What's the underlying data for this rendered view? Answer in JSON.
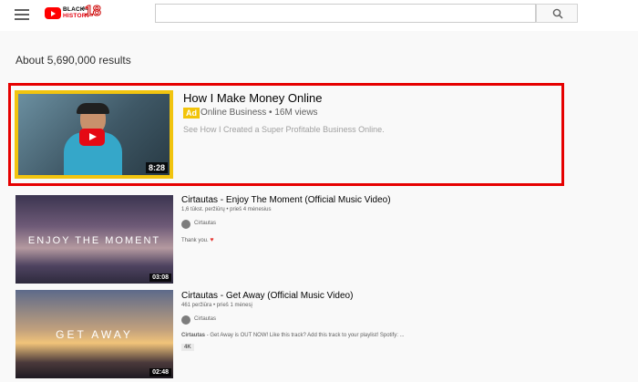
{
  "header": {
    "logo": {
      "line1": "BLACK",
      "line2": "HISTORY",
      "ag": "AG",
      "number": "18"
    },
    "search": {
      "value": "",
      "placeholder": ""
    }
  },
  "results": {
    "count_text": "About 5,690,000 results",
    "ad": {
      "title": "How I Make Money Online",
      "badge": "Ad",
      "meta": "Online Business • 16M views",
      "description": "See How I Created a Super Profitable Business Online.",
      "duration": "8:28"
    },
    "videos": [
      {
        "title": "Cirtautas - Enjoy The Moment (Official Music Video)",
        "stats": "1,6 tūkst. peržiūrų • prieš 4 mėnesius",
        "channel": "Cirtautas",
        "description": "Thank you.",
        "thumb_text": "ENJOY THE MOMENT",
        "duration": "03:08"
      },
      {
        "title": "Cirtautas - Get Away (Official Music Video)",
        "stats": "461 peržiūra • prieš 1 mėnesį",
        "channel": "Cirtautas",
        "description_channel": "Cirtautas",
        "description": "- Get Away is OUT NOW! Like this track? Add this track to your playlist! Spotify: ...",
        "badge": "4K",
        "thumb_text": "GET AWAY",
        "duration": "02:48"
      }
    ]
  },
  "colors": {
    "highlight": "#e60000",
    "ad_badge": "#f2c40a",
    "brand_red": "#ff0000"
  }
}
